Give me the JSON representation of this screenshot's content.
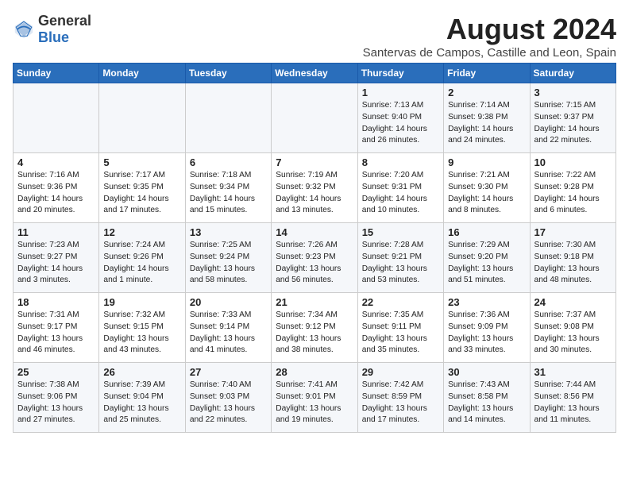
{
  "header": {
    "logo_general": "General",
    "logo_blue": "Blue",
    "title": "August 2024",
    "subtitle": "Santervas de Campos, Castille and Leon, Spain"
  },
  "weekdays": [
    "Sunday",
    "Monday",
    "Tuesday",
    "Wednesday",
    "Thursday",
    "Friday",
    "Saturday"
  ],
  "weeks": [
    [
      {
        "day": "",
        "info": ""
      },
      {
        "day": "",
        "info": ""
      },
      {
        "day": "",
        "info": ""
      },
      {
        "day": "",
        "info": ""
      },
      {
        "day": "1",
        "info": "Sunrise: 7:13 AM\nSunset: 9:40 PM\nDaylight: 14 hours\nand 26 minutes."
      },
      {
        "day": "2",
        "info": "Sunrise: 7:14 AM\nSunset: 9:38 PM\nDaylight: 14 hours\nand 24 minutes."
      },
      {
        "day": "3",
        "info": "Sunrise: 7:15 AM\nSunset: 9:37 PM\nDaylight: 14 hours\nand 22 minutes."
      }
    ],
    [
      {
        "day": "4",
        "info": "Sunrise: 7:16 AM\nSunset: 9:36 PM\nDaylight: 14 hours\nand 20 minutes."
      },
      {
        "day": "5",
        "info": "Sunrise: 7:17 AM\nSunset: 9:35 PM\nDaylight: 14 hours\nand 17 minutes."
      },
      {
        "day": "6",
        "info": "Sunrise: 7:18 AM\nSunset: 9:34 PM\nDaylight: 14 hours\nand 15 minutes."
      },
      {
        "day": "7",
        "info": "Sunrise: 7:19 AM\nSunset: 9:32 PM\nDaylight: 14 hours\nand 13 minutes."
      },
      {
        "day": "8",
        "info": "Sunrise: 7:20 AM\nSunset: 9:31 PM\nDaylight: 14 hours\nand 10 minutes."
      },
      {
        "day": "9",
        "info": "Sunrise: 7:21 AM\nSunset: 9:30 PM\nDaylight: 14 hours\nand 8 minutes."
      },
      {
        "day": "10",
        "info": "Sunrise: 7:22 AM\nSunset: 9:28 PM\nDaylight: 14 hours\nand 6 minutes."
      }
    ],
    [
      {
        "day": "11",
        "info": "Sunrise: 7:23 AM\nSunset: 9:27 PM\nDaylight: 14 hours\nand 3 minutes."
      },
      {
        "day": "12",
        "info": "Sunrise: 7:24 AM\nSunset: 9:26 PM\nDaylight: 14 hours\nand 1 minute."
      },
      {
        "day": "13",
        "info": "Sunrise: 7:25 AM\nSunset: 9:24 PM\nDaylight: 13 hours\nand 58 minutes."
      },
      {
        "day": "14",
        "info": "Sunrise: 7:26 AM\nSunset: 9:23 PM\nDaylight: 13 hours\nand 56 minutes."
      },
      {
        "day": "15",
        "info": "Sunrise: 7:28 AM\nSunset: 9:21 PM\nDaylight: 13 hours\nand 53 minutes."
      },
      {
        "day": "16",
        "info": "Sunrise: 7:29 AM\nSunset: 9:20 PM\nDaylight: 13 hours\nand 51 minutes."
      },
      {
        "day": "17",
        "info": "Sunrise: 7:30 AM\nSunset: 9:18 PM\nDaylight: 13 hours\nand 48 minutes."
      }
    ],
    [
      {
        "day": "18",
        "info": "Sunrise: 7:31 AM\nSunset: 9:17 PM\nDaylight: 13 hours\nand 46 minutes."
      },
      {
        "day": "19",
        "info": "Sunrise: 7:32 AM\nSunset: 9:15 PM\nDaylight: 13 hours\nand 43 minutes."
      },
      {
        "day": "20",
        "info": "Sunrise: 7:33 AM\nSunset: 9:14 PM\nDaylight: 13 hours\nand 41 minutes."
      },
      {
        "day": "21",
        "info": "Sunrise: 7:34 AM\nSunset: 9:12 PM\nDaylight: 13 hours\nand 38 minutes."
      },
      {
        "day": "22",
        "info": "Sunrise: 7:35 AM\nSunset: 9:11 PM\nDaylight: 13 hours\nand 35 minutes."
      },
      {
        "day": "23",
        "info": "Sunrise: 7:36 AM\nSunset: 9:09 PM\nDaylight: 13 hours\nand 33 minutes."
      },
      {
        "day": "24",
        "info": "Sunrise: 7:37 AM\nSunset: 9:08 PM\nDaylight: 13 hours\nand 30 minutes."
      }
    ],
    [
      {
        "day": "25",
        "info": "Sunrise: 7:38 AM\nSunset: 9:06 PM\nDaylight: 13 hours\nand 27 minutes."
      },
      {
        "day": "26",
        "info": "Sunrise: 7:39 AM\nSunset: 9:04 PM\nDaylight: 13 hours\nand 25 minutes."
      },
      {
        "day": "27",
        "info": "Sunrise: 7:40 AM\nSunset: 9:03 PM\nDaylight: 13 hours\nand 22 minutes."
      },
      {
        "day": "28",
        "info": "Sunrise: 7:41 AM\nSunset: 9:01 PM\nDaylight: 13 hours\nand 19 minutes."
      },
      {
        "day": "29",
        "info": "Sunrise: 7:42 AM\nSunset: 8:59 PM\nDaylight: 13 hours\nand 17 minutes."
      },
      {
        "day": "30",
        "info": "Sunrise: 7:43 AM\nSunset: 8:58 PM\nDaylight: 13 hours\nand 14 minutes."
      },
      {
        "day": "31",
        "info": "Sunrise: 7:44 AM\nSunset: 8:56 PM\nDaylight: 13 hours\nand 11 minutes."
      }
    ]
  ]
}
